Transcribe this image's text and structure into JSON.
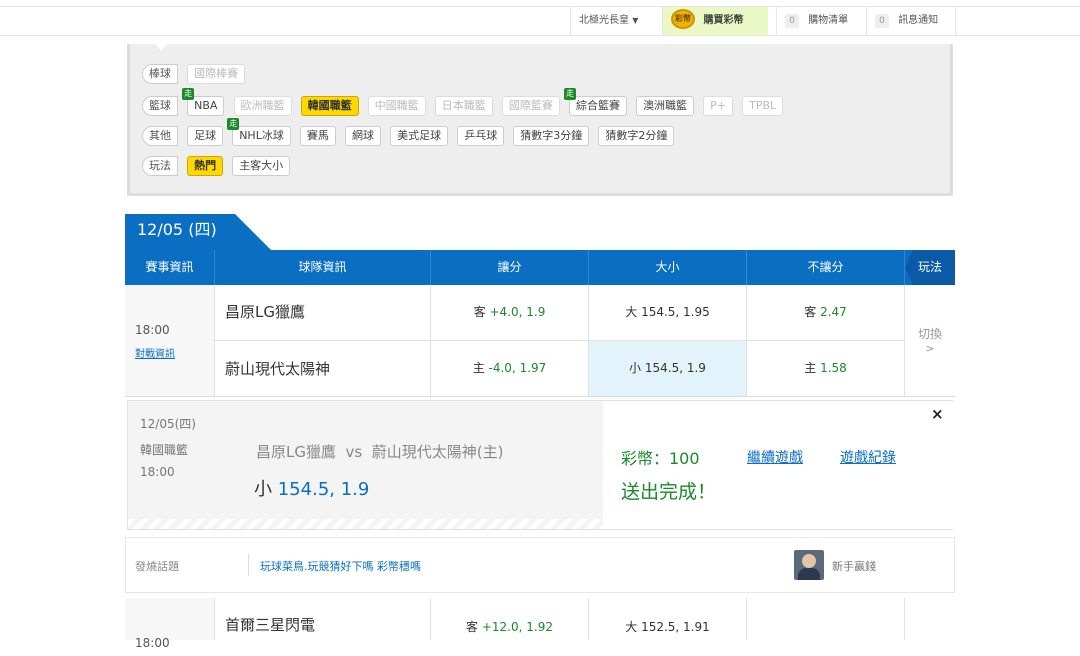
{
  "topbar": {
    "user": "北極光長皇",
    "buy_label": "購買彩幣",
    "coin_text": "彩幣",
    "cart_count": "0",
    "cart_label": "購物清單",
    "msg_count": "0",
    "msg_label": "訊息通知"
  },
  "filters": {
    "rows": [
      {
        "category": "棒球",
        "chips": [
          "國際棒賽"
        ]
      },
      {
        "category": "籃球",
        "chips": [
          "NBA",
          "歐洲職籃",
          "韓國職籃",
          "中國職籃",
          "日本職籃",
          "國際籃賽",
          "綜合籃賽",
          "澳洲職籃",
          "P+",
          "TPBL"
        ]
      },
      {
        "category": "其他",
        "chips": [
          "足球",
          "NHL冰球",
          "賽馬",
          "網球",
          "美式足球",
          "乒乓球",
          "猜數字3分鐘",
          "猜數字2分鐘"
        ]
      },
      {
        "category": "玩法",
        "chips": [
          "熱門",
          "主客大小"
        ]
      }
    ],
    "live_badge": "走"
  },
  "date_tab": "12/05 (四)",
  "table": {
    "headers": [
      "賽事資訊",
      "球隊資訊",
      "讓分",
      "大小",
      "不讓分",
      "玩法"
    ],
    "match": {
      "time": "18:00",
      "info_link": "對戰資訊",
      "away_team": "昌原LG獵鷹",
      "home_team": "蔚山現代太陽神",
      "spread_away_tag": "客",
      "spread_away": "+4.0, 1.9",
      "spread_home_tag": "主",
      "spread_home": "-4.0, 1.97",
      "ou_over_tag": "大",
      "ou_over": "154.5, 1.95",
      "ou_under_tag": "小",
      "ou_under": "154.5, 1.9",
      "ml_away_tag": "客",
      "ml_away": "2.47",
      "ml_home_tag": "主",
      "ml_home": "1.58",
      "switch_label": "切換",
      "switch_arrow": ">"
    }
  },
  "popup": {
    "date": "12/05(四)",
    "league": "韓國職籃",
    "time": "18:00",
    "matchup": "昌原LG獵鷹  vs  蔚山現代太陽神(主)",
    "pick_tag": "小",
    "pick_value": "154.5, 1.9",
    "coins": "彩幣：100",
    "status": "送出完成！",
    "continue_link": "繼續遊戲",
    "record_link": "遊戲紀錄",
    "close": "×"
  },
  "topic": {
    "label": "發燒話題",
    "title": "玩球菜鳥.玩競猜好下嗎 彩幣穩嗎",
    "author": "新手贏錢"
  },
  "next_match": {
    "time": "18:00",
    "away_team": "首爾三星閃電",
    "spread_away_tag": "客",
    "spread_away": "+12.0, 1.92",
    "ou_over_tag": "大",
    "ou_over": "152.5, 1.91"
  },
  "colors": {
    "primary": "#0a6ec2",
    "accent": "#ffd800",
    "odds": "#1a8a2a"
  }
}
